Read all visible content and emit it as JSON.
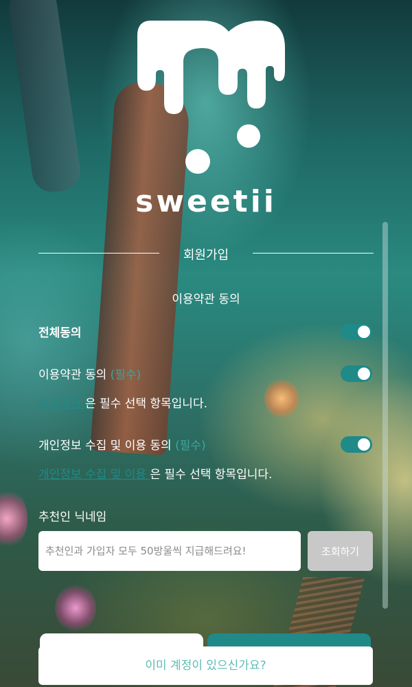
{
  "brand": {
    "name": "sweetii"
  },
  "page": {
    "section_title": "회원가입",
    "terms_heading": "이용약관 동의"
  },
  "consents": {
    "all": {
      "label": "전체동의",
      "on": true
    },
    "terms": {
      "label": "이용약관 동의",
      "required_tag": "(필수)",
      "on": true,
      "link_text": "이용약관 ",
      "note_suffix": " 은 필수 선택 항목입니다."
    },
    "privacy": {
      "label": "개인정보 수집 및 이용 동의",
      "required_tag": "(필수)",
      "on": true,
      "link_text": "개인정보 수집 및 이용 ",
      "note_suffix": " 은 필수 선택 항목입니다."
    }
  },
  "referral": {
    "label": "추천인 닉네임",
    "placeholder": "추천인과 가입자 모두 50방울씩 지급해드려요!",
    "value": "",
    "check_button": "조회하기"
  },
  "footer": {
    "login_link": "이미 계정이 있으신가요?"
  },
  "colors": {
    "accent": "#1f8a88",
    "required": "#3aa6a0",
    "login_text": "#5cbcb6",
    "button_disabled": "#c8c8c8"
  },
  "icons": {
    "logo": "drip-m-logo"
  }
}
